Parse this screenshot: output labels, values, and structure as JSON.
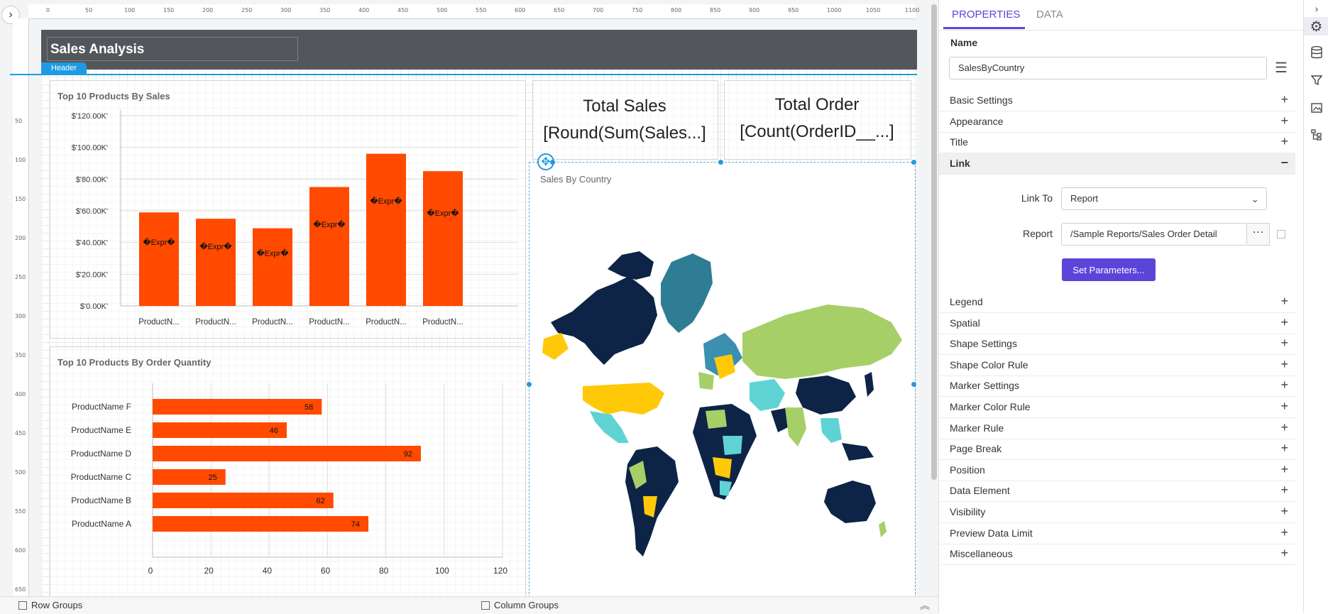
{
  "report": {
    "title": "Sales Analysis",
    "header_tab": "Header",
    "ruler_top": [
      "0",
      "50",
      "100",
      "150",
      "200",
      "250",
      "300",
      "350",
      "400",
      "450",
      "500",
      "550",
      "600",
      "650",
      "700",
      "750",
      "800",
      "850",
      "900",
      "950",
      "1000",
      "1050",
      "1100"
    ],
    "ruler_left": [
      "50",
      "100",
      "150",
      "200",
      "250",
      "300",
      "350",
      "400",
      "450",
      "500",
      "550",
      "600",
      "650"
    ]
  },
  "charts": {
    "sales_by_product": {
      "title": "Top 10 Products By Sales",
      "y_ticks": [
        "$'120.00K'",
        "$'100.00K'",
        "$'80.00K'",
        "$'60.00K'",
        "$'40.00K'",
        "$'20.00K'",
        "$'0.00K'"
      ],
      "bar_label": "�Expr�"
    },
    "order_quantity": {
      "title": "Top 10 Products By Order Quantity"
    }
  },
  "chart_data": [
    {
      "type": "bar",
      "title": "Top 10 Products By Sales",
      "categories": [
        "ProductN...",
        "ProductN...",
        "ProductN...",
        "ProductN...",
        "ProductN...",
        "ProductN..."
      ],
      "values": [
        59000,
        55000,
        49000,
        75000,
        96000,
        85000
      ],
      "ylim": [
        0,
        120000
      ],
      "data_labels": [
        "�Expr�",
        "�Expr�",
        "�Expr�",
        "�Expr�",
        "�Expr�",
        "�Expr�"
      ],
      "color": "#ff4a00",
      "grid": true
    },
    {
      "type": "bar",
      "orientation": "horizontal",
      "title": "Top 10 Products By Order Quantity",
      "categories": [
        "ProductName F",
        "ProductName E",
        "ProductName D",
        "ProductName C",
        "ProductName B",
        "ProductName A"
      ],
      "values": [
        58,
        46,
        92,
        25,
        62,
        74
      ],
      "x_ticks": [
        "0",
        "20",
        "40",
        "60",
        "80",
        "100",
        "120"
      ],
      "xlim": [
        0,
        120
      ],
      "color": "#ff4a00",
      "grid": true
    }
  ],
  "kpis": {
    "total_sales": {
      "title": "Total Sales",
      "value": "[Round(Sum(Sales...]"
    },
    "total_order": {
      "title": "Total Order",
      "value": "[Count(OrderID__...]"
    }
  },
  "map": {
    "title": "Sales By Country",
    "colors": [
      "#0d2447",
      "#2e7d94",
      "#a7cf68",
      "#5fd3d3",
      "#ffc90a",
      "#3b8fb0"
    ]
  },
  "bottom": {
    "row_groups": "Row Groups",
    "column_groups": "Column Groups"
  },
  "properties": {
    "tabs": [
      "PROPERTIES",
      "DATA"
    ],
    "name_label": "Name",
    "name_value": "SalesByCountry",
    "sections_top": [
      {
        "label": "Basic Settings",
        "sign": "+"
      },
      {
        "label": "Appearance",
        "sign": "+"
      },
      {
        "label": "Title",
        "sign": "+"
      },
      {
        "label": "Link",
        "sign": "−"
      }
    ],
    "link": {
      "link_to_label": "Link To",
      "link_to_value": "Report",
      "report_label": "Report",
      "report_value": "/Sample Reports/Sales Order Detail",
      "set_parameters": "Set Parameters..."
    },
    "sections_bottom": [
      {
        "label": "Legend",
        "sign": "+"
      },
      {
        "label": "Spatial",
        "sign": "+"
      },
      {
        "label": "Shape Settings",
        "sign": "+"
      },
      {
        "label": "Shape Color Rule",
        "sign": "+"
      },
      {
        "label": "Marker Settings",
        "sign": "+"
      },
      {
        "label": "Marker Color Rule",
        "sign": "+"
      },
      {
        "label": "Marker Rule",
        "sign": "+"
      },
      {
        "label": "Page Break",
        "sign": "+"
      },
      {
        "label": "Position",
        "sign": "+"
      },
      {
        "label": "Data Element",
        "sign": "+"
      },
      {
        "label": "Visibility",
        "sign": "+"
      },
      {
        "label": "Preview Data Limit",
        "sign": "+"
      },
      {
        "label": "Miscellaneous",
        "sign": "+"
      }
    ]
  },
  "theme": {
    "accent": "#5b45d9",
    "selection_blue": "#1e9be0",
    "bar_color": "#ff4a00",
    "header_bg": "#53575c"
  }
}
